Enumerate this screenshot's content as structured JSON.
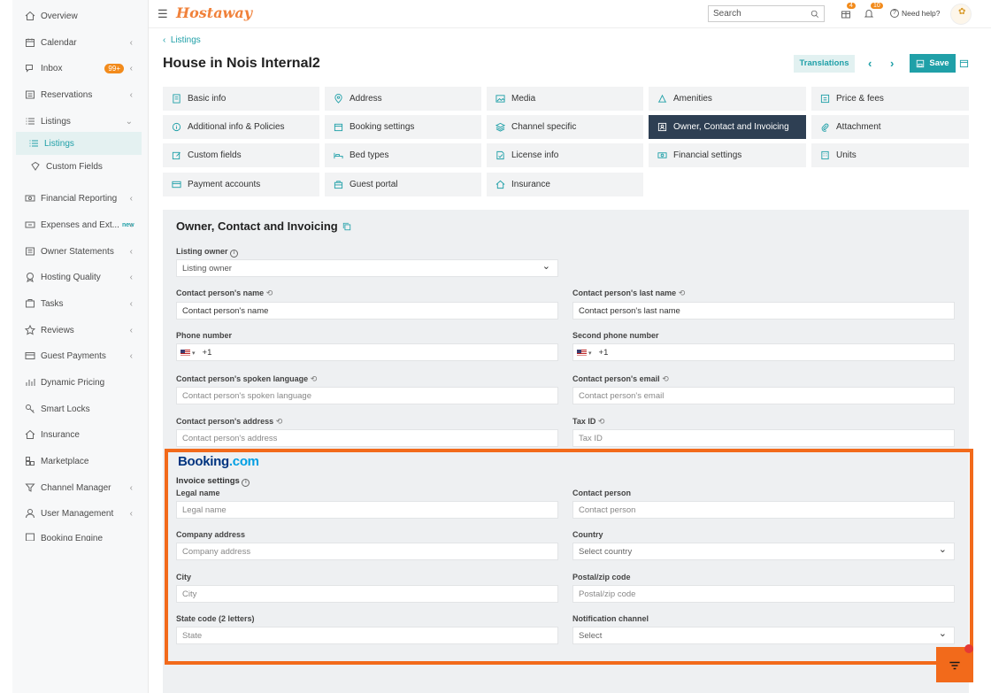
{
  "sidebar": {
    "items": [
      {
        "label": "Overview",
        "icon": "home-icon"
      },
      {
        "label": "Calendar",
        "icon": "calendar-icon"
      },
      {
        "label": "Inbox",
        "icon": "inbox-icon",
        "badge": "99+"
      },
      {
        "label": "Reservations",
        "icon": "reservations-icon"
      },
      {
        "label": "Listings",
        "icon": "list-icon"
      },
      {
        "label": "Listings",
        "icon": "list-icon"
      },
      {
        "label": "Custom Fields",
        "icon": "tag-icon"
      },
      {
        "label": "Financial Reporting",
        "icon": "money-icon"
      },
      {
        "label": "Expenses and Ext...",
        "icon": "expenses-icon",
        "tag": "new"
      },
      {
        "label": "Owner Statements",
        "icon": "statement-icon"
      },
      {
        "label": "Hosting Quality",
        "icon": "quality-icon"
      },
      {
        "label": "Tasks",
        "icon": "tasks-icon"
      },
      {
        "label": "Reviews",
        "icon": "star-icon"
      },
      {
        "label": "Guest Payments",
        "icon": "card-icon"
      },
      {
        "label": "Dynamic Pricing",
        "icon": "chart-icon"
      },
      {
        "label": "Smart Locks",
        "icon": "key-icon"
      },
      {
        "label": "Insurance",
        "icon": "insurance-icon"
      },
      {
        "label": "Marketplace",
        "icon": "marketplace-icon"
      },
      {
        "label": "Channel Manager",
        "icon": "channel-icon"
      },
      {
        "label": "User Management",
        "icon": "user-icon"
      },
      {
        "label": "Booking Engine",
        "icon": "engine-icon"
      }
    ]
  },
  "topbar": {
    "logo": "Hostaway",
    "search_placeholder": "Search",
    "notif_count1": "4",
    "notif_count2": "10",
    "help": "Need help?"
  },
  "breadcrumb": "Listings",
  "page_title": "House in Nois Internal2",
  "buttons": {
    "translations": "Translations",
    "save": "Save"
  },
  "tabs": [
    "Basic info",
    "Address",
    "Media",
    "Amenities",
    "Price & fees",
    "Additional info & Policies",
    "Booking settings",
    "Channel specific",
    "Owner, Contact and Invoicing",
    "Attachment",
    "Custom fields",
    "Bed types",
    "License info",
    "Financial settings",
    "Units",
    "Payment accounts",
    "Guest portal",
    "Insurance"
  ],
  "section": {
    "title": "Owner, Contact and Invoicing"
  },
  "fields": {
    "listing_owner": {
      "label": "Listing owner",
      "value": "Listing owner"
    },
    "contact_name": {
      "label": "Contact person's name",
      "value": "Contact person's name"
    },
    "contact_last": {
      "label": "Contact person's last name",
      "value": "Contact person's last name"
    },
    "phone": {
      "label": "Phone number",
      "value": "+1"
    },
    "phone2": {
      "label": "Second phone number",
      "value": "+1"
    },
    "language": {
      "label": "Contact person's spoken language",
      "placeholder": "Contact person's spoken language"
    },
    "email": {
      "label": "Contact person's email",
      "placeholder": "Contact person's email"
    },
    "address": {
      "label": "Contact person's address",
      "placeholder": "Contact person's address"
    },
    "tax": {
      "label": "Tax ID",
      "placeholder": "Tax ID"
    }
  },
  "invoice": {
    "brand_main": "Booking",
    "brand_suffix": ".com",
    "settings_label": "Invoice settings",
    "legal_name": {
      "label": "Legal name",
      "placeholder": "Legal name"
    },
    "contact_person": {
      "label": "Contact person",
      "placeholder": "Contact person"
    },
    "company_address": {
      "label": "Company address",
      "placeholder": "Company address"
    },
    "country": {
      "label": "Country",
      "placeholder": "Select country"
    },
    "city": {
      "label": "City",
      "placeholder": "City"
    },
    "zip": {
      "label": "Postal/zip code",
      "placeholder": "Postal/zip code"
    },
    "state": {
      "label": "State code (2 letters)",
      "placeholder": "State"
    },
    "notification": {
      "label": "Notification channel",
      "placeholder": "Select"
    }
  },
  "colors": {
    "accent": "#20a0a8",
    "highlight": "#f26a1b",
    "active_tab": "#2e3f53"
  }
}
